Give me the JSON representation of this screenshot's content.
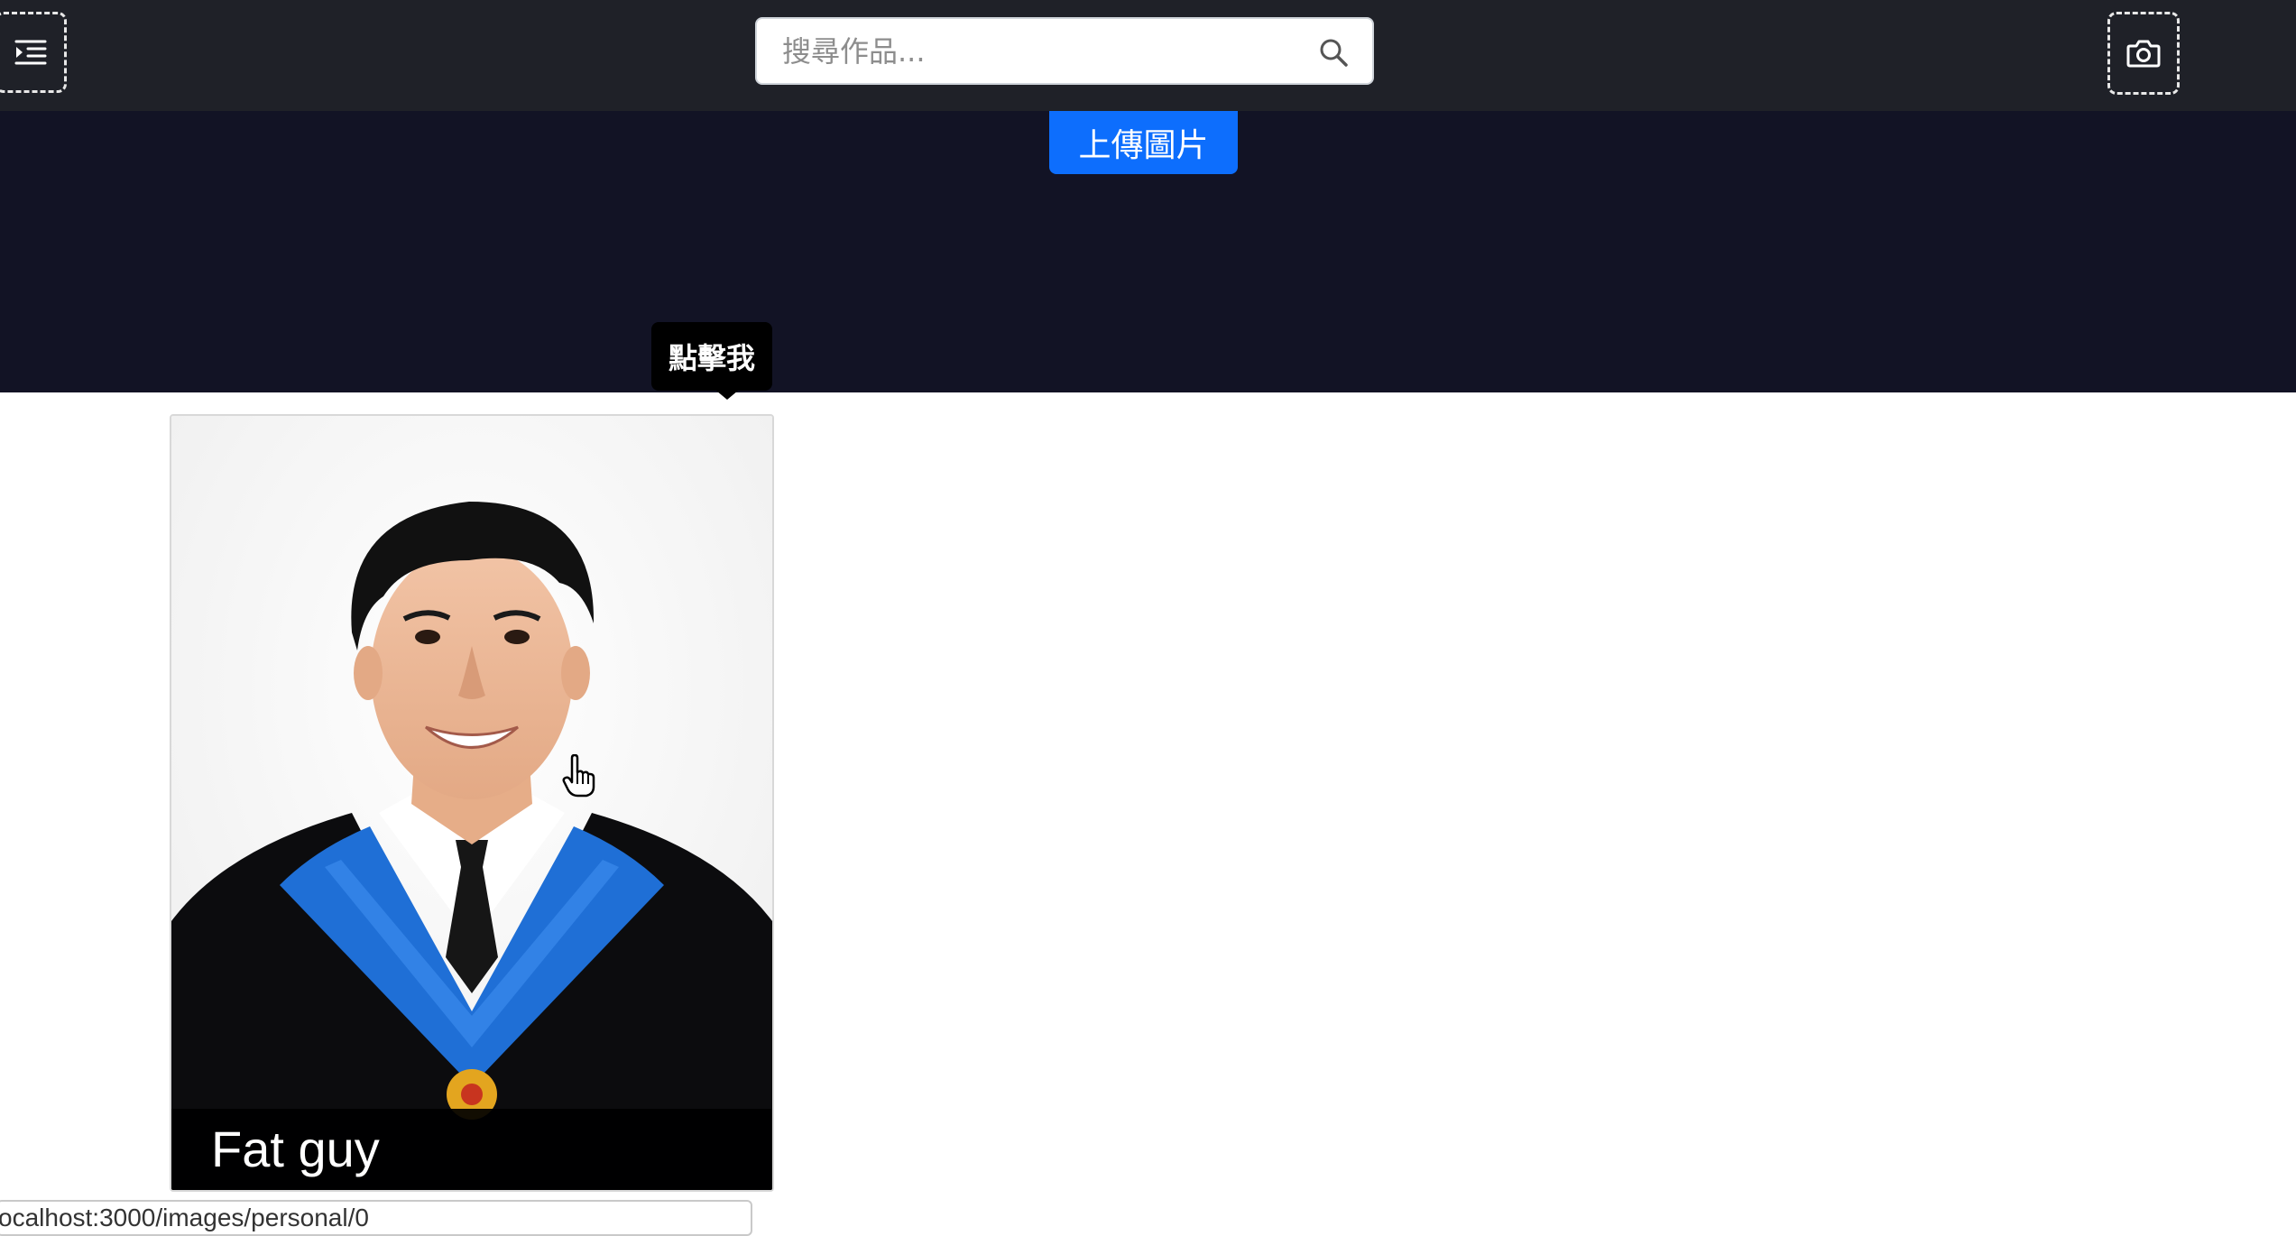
{
  "header": {
    "menu_icon": "indent-menu-icon",
    "camera_icon": "camera-icon",
    "search": {
      "placeholder": "搜尋作品...",
      "value": "",
      "icon": "search-icon"
    }
  },
  "hero": {
    "upload_button_label": "上傳圖片",
    "tooltip_text": "點擊我"
  },
  "gallery": {
    "cards": [
      {
        "title": "Fat guy"
      }
    ]
  },
  "status_bar": {
    "url": "ocalhost:3000/images/personal/0"
  },
  "colors": {
    "topbar": "#1f2128",
    "hero": "#121325",
    "primary": "#0d6efd",
    "gown_accent": "#1f6fd6"
  }
}
